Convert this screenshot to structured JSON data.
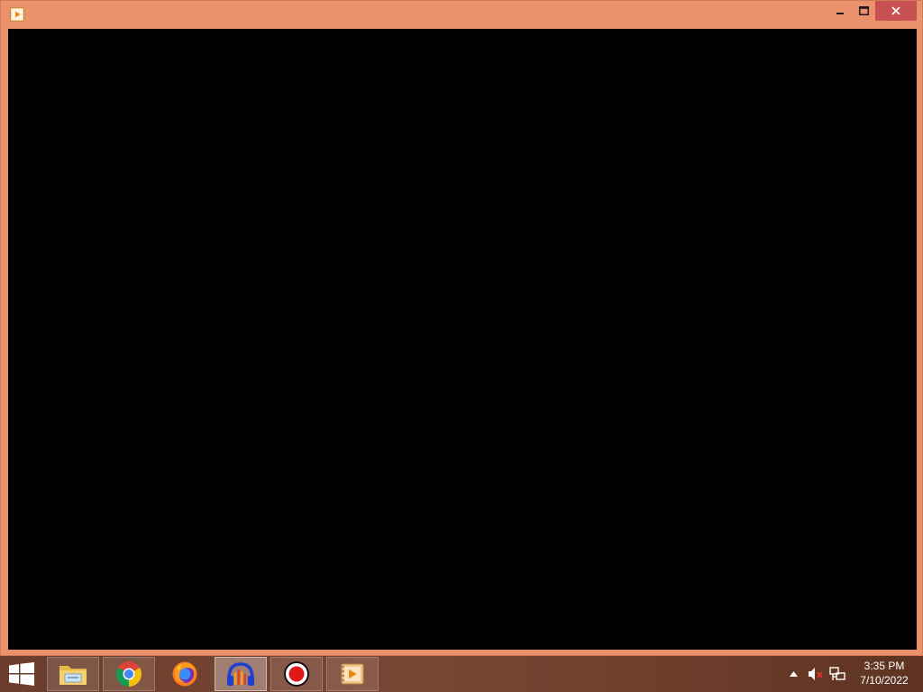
{
  "window": {
    "app_icon": "media-player-icon",
    "controls": {
      "minimize_icon": "minimize-icon",
      "maximize_icon": "maximize-icon",
      "close_icon": "close-icon"
    }
  },
  "taskbar": {
    "start_icon": "windows-logo-icon",
    "apps": [
      {
        "name": "file-explorer",
        "icon": "folder-icon"
      },
      {
        "name": "google-chrome",
        "icon": "chrome-icon"
      },
      {
        "name": "firefox",
        "icon": "firefox-icon"
      },
      {
        "name": "audacity",
        "icon": "headphones-icon"
      },
      {
        "name": "screen-recorder",
        "icon": "record-icon"
      },
      {
        "name": "media-player",
        "icon": "media-player-icon"
      }
    ],
    "tray": {
      "show_hidden_icon": "chevron-up-icon",
      "volume_icon": "volume-muted-icon",
      "network_icon": "network-icon"
    },
    "clock": {
      "time": "3:35 PM",
      "date": "7/10/2022"
    }
  },
  "colors": {
    "accent": "#e9926b",
    "close_button": "#c75050",
    "content_background": "#000000"
  }
}
